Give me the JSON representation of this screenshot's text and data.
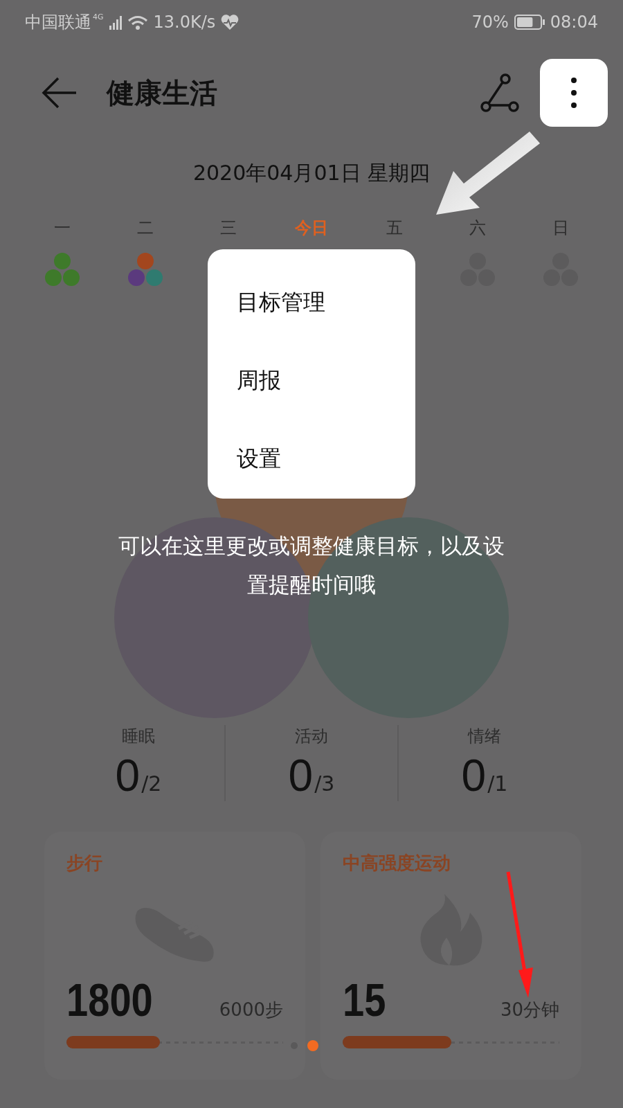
{
  "status_bar": {
    "carrier": "中国联通",
    "network": "4G",
    "speed": "13.0K/s",
    "battery": "70%",
    "time": "08:04"
  },
  "header": {
    "title": "健康生活"
  },
  "date": "2020年04月01日 星期四",
  "days": [
    {
      "label": "一",
      "selected": false,
      "kind": "complete"
    },
    {
      "label": "二",
      "selected": false,
      "kind": "partial"
    },
    {
      "label": "三",
      "selected": false,
      "kind": "hidden"
    },
    {
      "label": "今日",
      "selected": true,
      "kind": "hidden"
    },
    {
      "label": "五",
      "selected": false,
      "kind": "hidden"
    },
    {
      "label": "六",
      "selected": false,
      "kind": "empty"
    },
    {
      "label": "日",
      "selected": false,
      "kind": "empty"
    }
  ],
  "menu": {
    "items": [
      "目标管理",
      "周报",
      "设置"
    ]
  },
  "tip": "可以在这里更改或调整健康目标，以及设置提醒时间哦",
  "stats": [
    {
      "label": "睡眠",
      "value": "0",
      "goal": "/2"
    },
    {
      "label": "活动",
      "value": "0",
      "goal": "/3"
    },
    {
      "label": "情绪",
      "value": "0",
      "goal": "/1"
    }
  ],
  "cards": [
    {
      "kind": "steps",
      "title": "步行",
      "value": "1800",
      "goal": "6000步",
      "level": 0.43
    },
    {
      "kind": "intensity",
      "title": "中高强度运动",
      "value": "15",
      "goal": "30分钟",
      "level": 0.5
    }
  ],
  "pager": [
    {
      "selected": false
    },
    {
      "selected": true
    }
  ]
}
